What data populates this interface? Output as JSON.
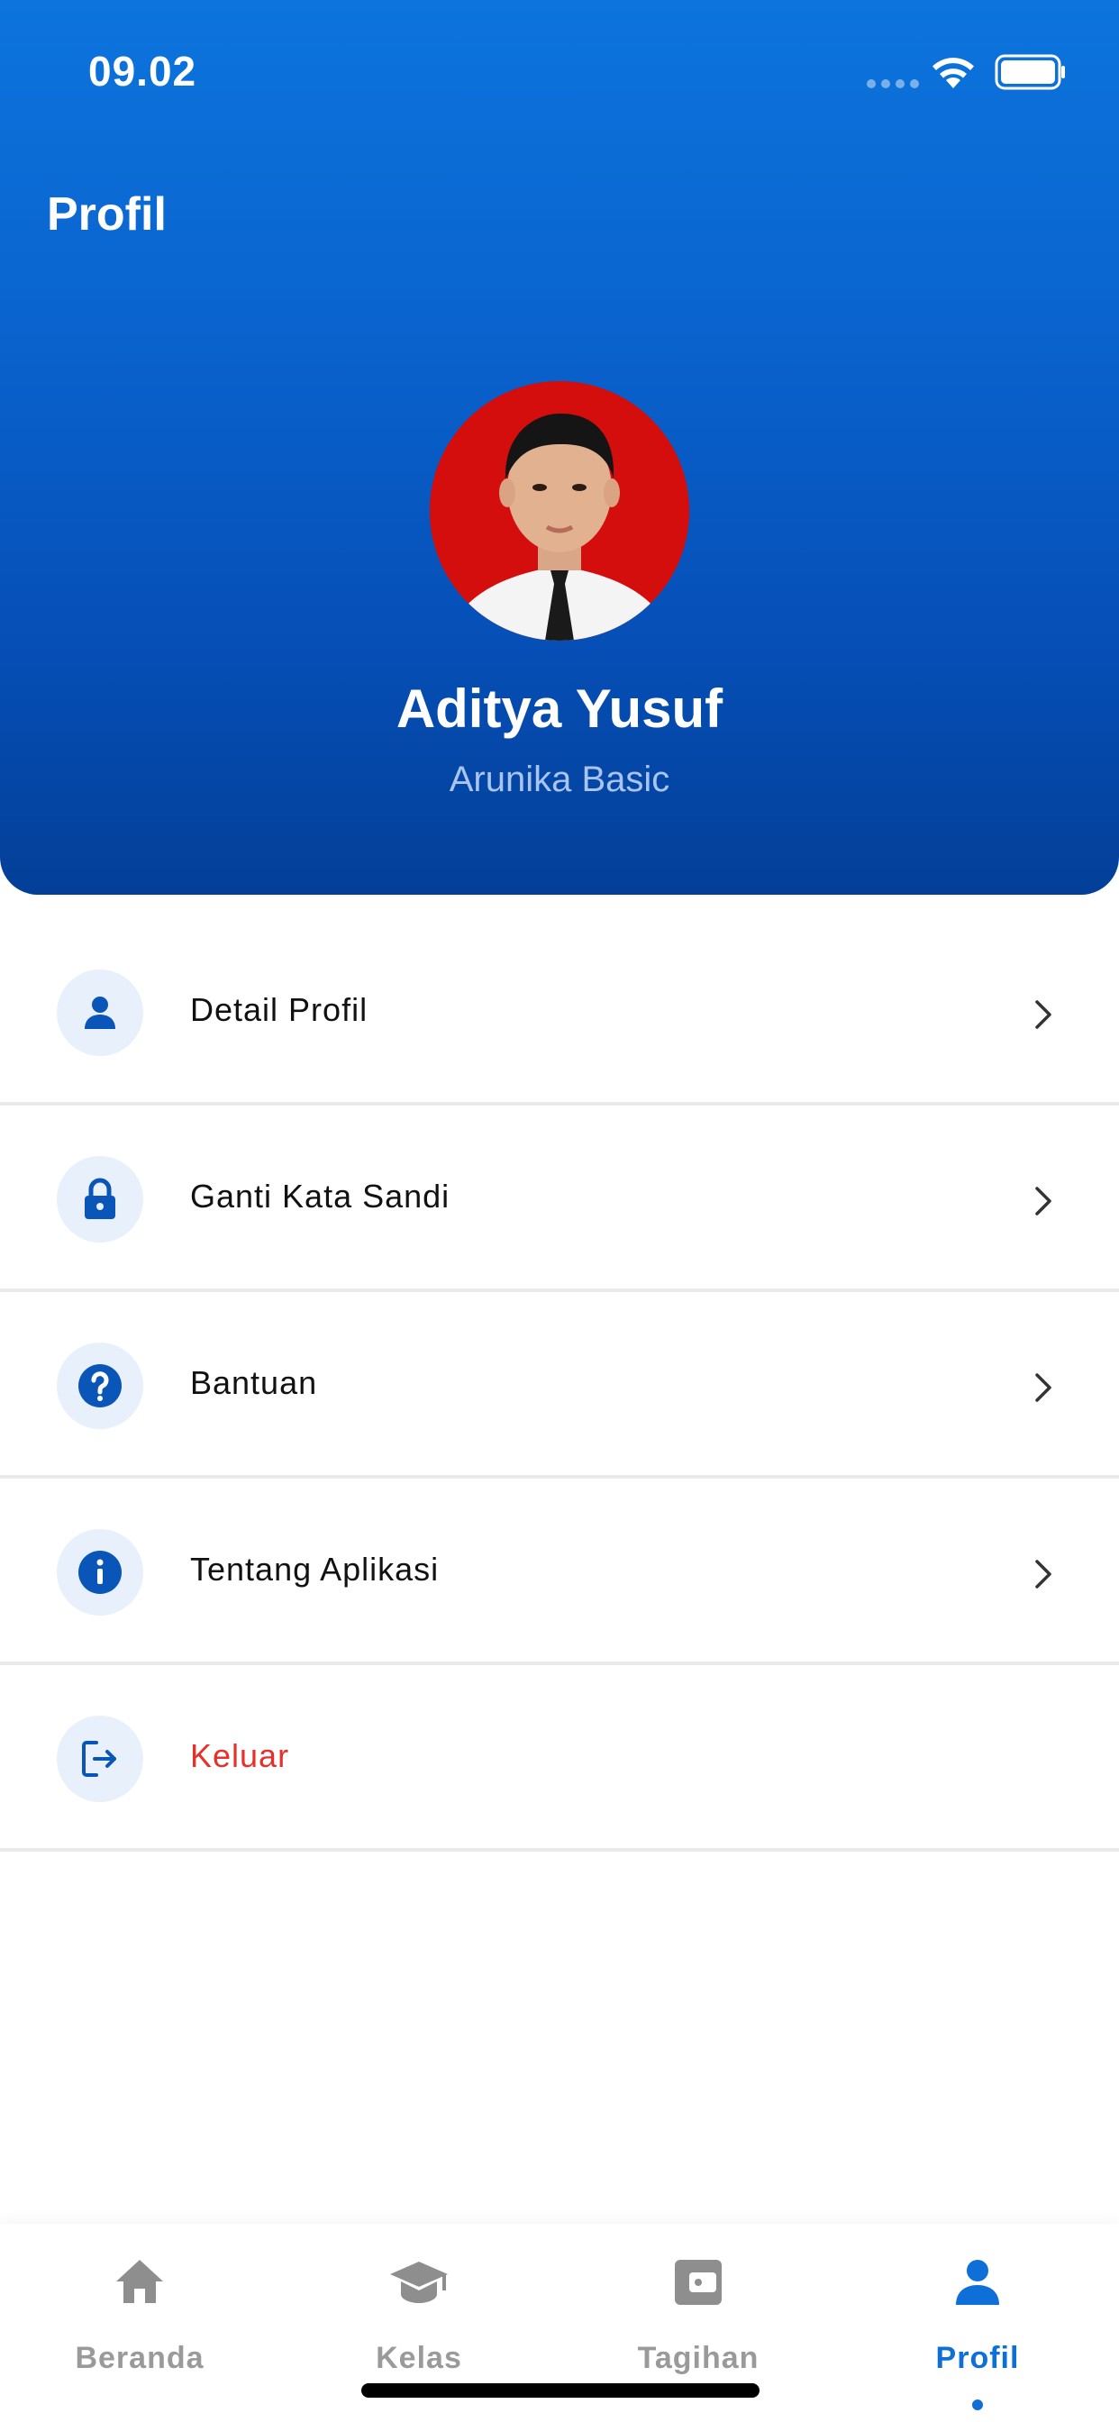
{
  "status_bar": {
    "time": "09.02"
  },
  "header": {
    "title": "Profil",
    "user_name": "Aditya Yusuf",
    "user_plan": "Arunika Basic",
    "gradient_colors": [
      "#0d74dd",
      "#033f98"
    ]
  },
  "menu": {
    "items": [
      {
        "label": "Detail Profil",
        "icon": "person-icon"
      },
      {
        "label": "Ganti Kata Sandi",
        "icon": "lock-icon"
      },
      {
        "label": "Bantuan",
        "icon": "question-circle-icon"
      },
      {
        "label": "Tentang Aplikasi",
        "icon": "info-circle-icon"
      },
      {
        "label": "Keluar",
        "icon": "logout-icon",
        "color": "#e4322a"
      }
    ]
  },
  "bottom_nav": {
    "active": "Profil",
    "items": [
      {
        "label": "Beranda",
        "icon": "home-icon"
      },
      {
        "label": "Kelas",
        "icon": "graduation-cap-icon"
      },
      {
        "label": "Tagihan",
        "icon": "wallet-icon"
      },
      {
        "label": "Profil",
        "icon": "person-icon"
      }
    ]
  },
  "colors": {
    "accent": "#0f6fd8",
    "danger": "#e4322a",
    "inactive": "#9a9a9a"
  }
}
